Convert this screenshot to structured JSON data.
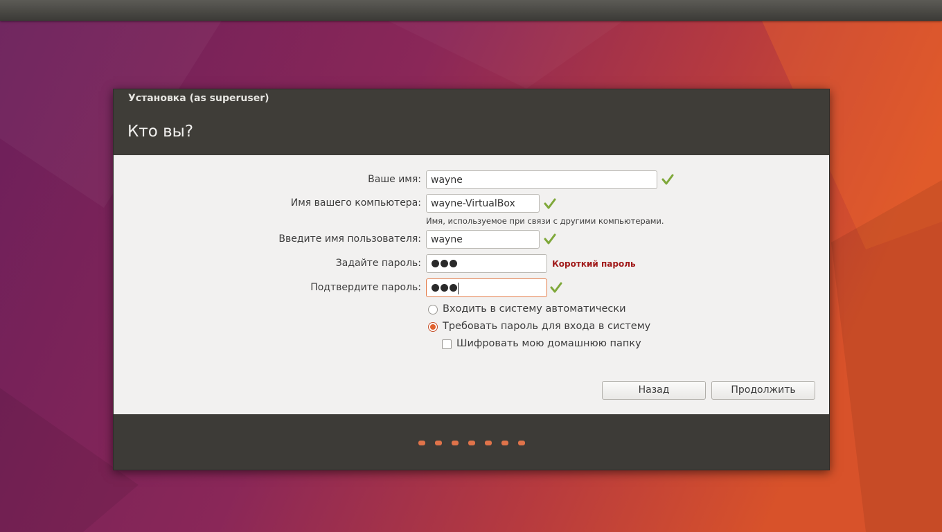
{
  "window": {
    "title": "Установка (as superuser)",
    "heading": "Кто вы?"
  },
  "form": {
    "name_label": "Ваше имя:",
    "name_value": "wayne",
    "computer_label": "Имя вашего компьютера:",
    "computer_value": "wayne-VirtualBox",
    "computer_hint": "Имя, используемое при связи с другими компьютерами.",
    "username_label": "Введите имя пользователя:",
    "username_value": "wayne",
    "password_label": "Задайте пароль:",
    "password_warning": "Короткий пароль",
    "confirm_label": "Подтвердите пароль:",
    "password_length": 3,
    "confirm_length": 3
  },
  "options": {
    "auto_login": "Входить в систему автоматически",
    "require_password": "Требовать пароль для входа в систему",
    "encrypt_home": "Шифровать мою домашнюю папку",
    "selected": "require_password",
    "encrypt_checked": false
  },
  "buttons": {
    "back": "Назад",
    "continue": "Продолжить"
  },
  "progress": {
    "steps": 7
  },
  "colors": {
    "accent": "#e0622e",
    "check": "#7fa83a",
    "warning": "#a11b1b",
    "header": "#3f3d38"
  }
}
